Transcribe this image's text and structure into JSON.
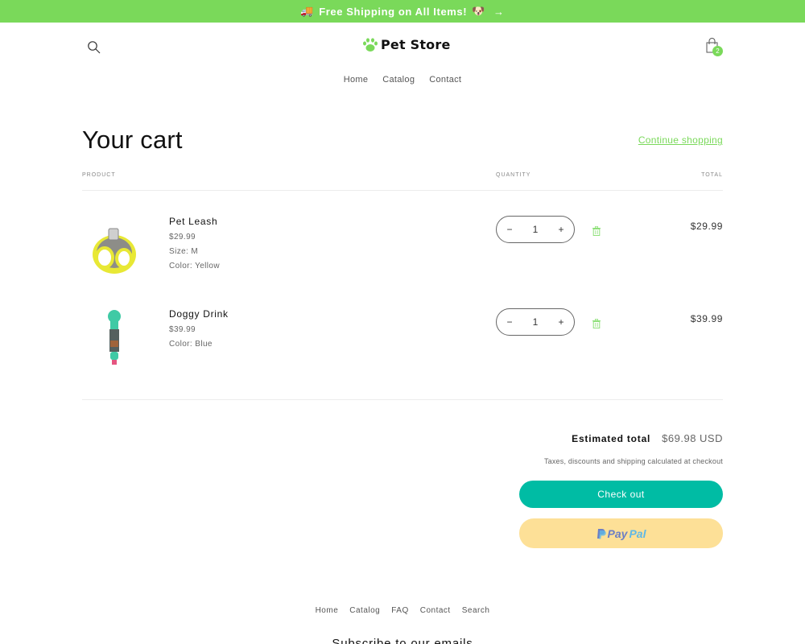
{
  "announcement": {
    "text": "Free Shipping on All Items!",
    "leading_emoji": "🚚",
    "trailing_emoji": "🐶",
    "arrow": "→",
    "bg_color": "#7ad95a"
  },
  "header": {
    "logo_text": "Pet Store",
    "cart_count": "2",
    "nav": [
      "Home",
      "Catalog",
      "Contact"
    ],
    "accent_color": "#7ad95a"
  },
  "cart": {
    "title": "Your cart",
    "continue_label": "Continue shopping",
    "columns": {
      "product": "PRODUCT",
      "quantity": "QUANTITY",
      "total": "TOTAL"
    },
    "items": [
      {
        "name": "Pet Leash",
        "price": "$29.99",
        "options": [
          "Size: M",
          "Color: Yellow"
        ],
        "quantity": "1",
        "line_total": "$29.99",
        "image": "yellow-harness"
      },
      {
        "name": "Doggy Drink",
        "price": "$39.99",
        "options": [
          "Color: Blue"
        ],
        "quantity": "1",
        "line_total": "$39.99",
        "image": "teal-water-bottle"
      }
    ],
    "qty_minus": "−",
    "qty_plus": "+"
  },
  "summary": {
    "estimated_label": "Estimated total",
    "estimated_value": "$69.98 USD",
    "tax_note": "Taxes, discounts and shipping calculated at checkout",
    "checkout_label": "Check out",
    "checkout_color": "#00bca4",
    "paypal_a": "Pay",
    "paypal_b": "Pal",
    "paypal_color": "#fde097"
  },
  "footer": {
    "nav": [
      "Home",
      "Catalog",
      "FAQ",
      "Contact",
      "Search"
    ],
    "subscribe_heading": "Subscribe to our emails"
  }
}
